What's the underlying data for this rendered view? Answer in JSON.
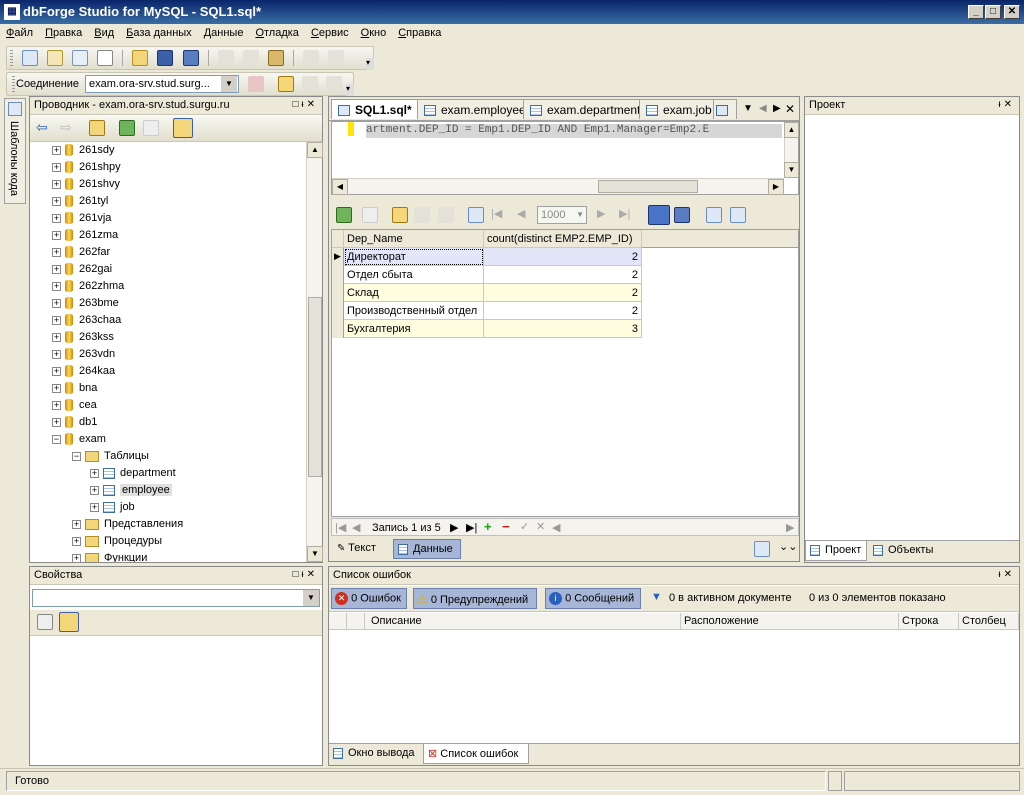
{
  "window": {
    "title": "dbForge Studio for MySQL - SQL1.sql*"
  },
  "menu": [
    "Файл",
    "Правка",
    "Вид",
    "База данных",
    "Данные",
    "Отладка",
    "Сервис",
    "Окно",
    "Справка"
  ],
  "connection": {
    "label": "Соединение",
    "value": "exam.ora-srv.stud.surg..."
  },
  "side_tab": "Шаблоны кода",
  "explorer": {
    "title": "Проводник - exam.ora-srv.stud.surgu.ru",
    "items": [
      "261sdy",
      "261shpy",
      "261shvy",
      "261tyl",
      "261vja",
      "261zma",
      "262far",
      "262gai",
      "262zhma",
      "263bme",
      "263chaa",
      "263kss",
      "263vdn",
      "264kaa",
      "bna",
      "cea",
      "db1",
      "exam"
    ],
    "tables_folder": "Таблицы",
    "tables": [
      "department",
      "employee",
      "job"
    ],
    "folders": [
      "Представления",
      "Процедуры",
      "Функции"
    ]
  },
  "properties": {
    "title": "Свойства"
  },
  "doc_tabs": [
    "SQL1.sql*",
    "exam.employee",
    "exam.department",
    "exam.job"
  ],
  "editor": {
    "text": "artment.DEP_ID = Emp1.DEP_ID AND Emp1.Manager=Emp2.E"
  },
  "grid_toolbar": {
    "page_size": "1000"
  },
  "grid": {
    "columns": [
      "Dep_Name",
      "count(distinct EMP2.EMP_ID)"
    ],
    "rows": [
      {
        "name": "Директорат",
        "count": "2"
      },
      {
        "name": "Отдел сбыта",
        "count": "2"
      },
      {
        "name": "Склад",
        "count": "2"
      },
      {
        "name": "Производственный отдел",
        "count": "2"
      },
      {
        "name": "Бухгалтерия",
        "count": "3"
      }
    ]
  },
  "nav": {
    "record": "Запись 1 из 5"
  },
  "bottom_tabs": {
    "text": "Текст",
    "data": "Данные"
  },
  "project": {
    "title": "Проект",
    "tab_project": "Проект",
    "tab_objects": "Объекты"
  },
  "errors": {
    "title": "Список ошибок",
    "errors_btn": "0 Ошибок",
    "warnings_btn": "0 Предупреждений",
    "messages_btn": "0 Сообщений",
    "filter": "0 в активном документе",
    "shown": "0 из 0 элементов показано",
    "columns": [
      "Описание",
      "Расположение",
      "Строка",
      "Столбец"
    ]
  },
  "output_tabs": {
    "output": "Окно вывода",
    "errors": "Список ошибок"
  },
  "status": {
    "text": "Готово"
  }
}
